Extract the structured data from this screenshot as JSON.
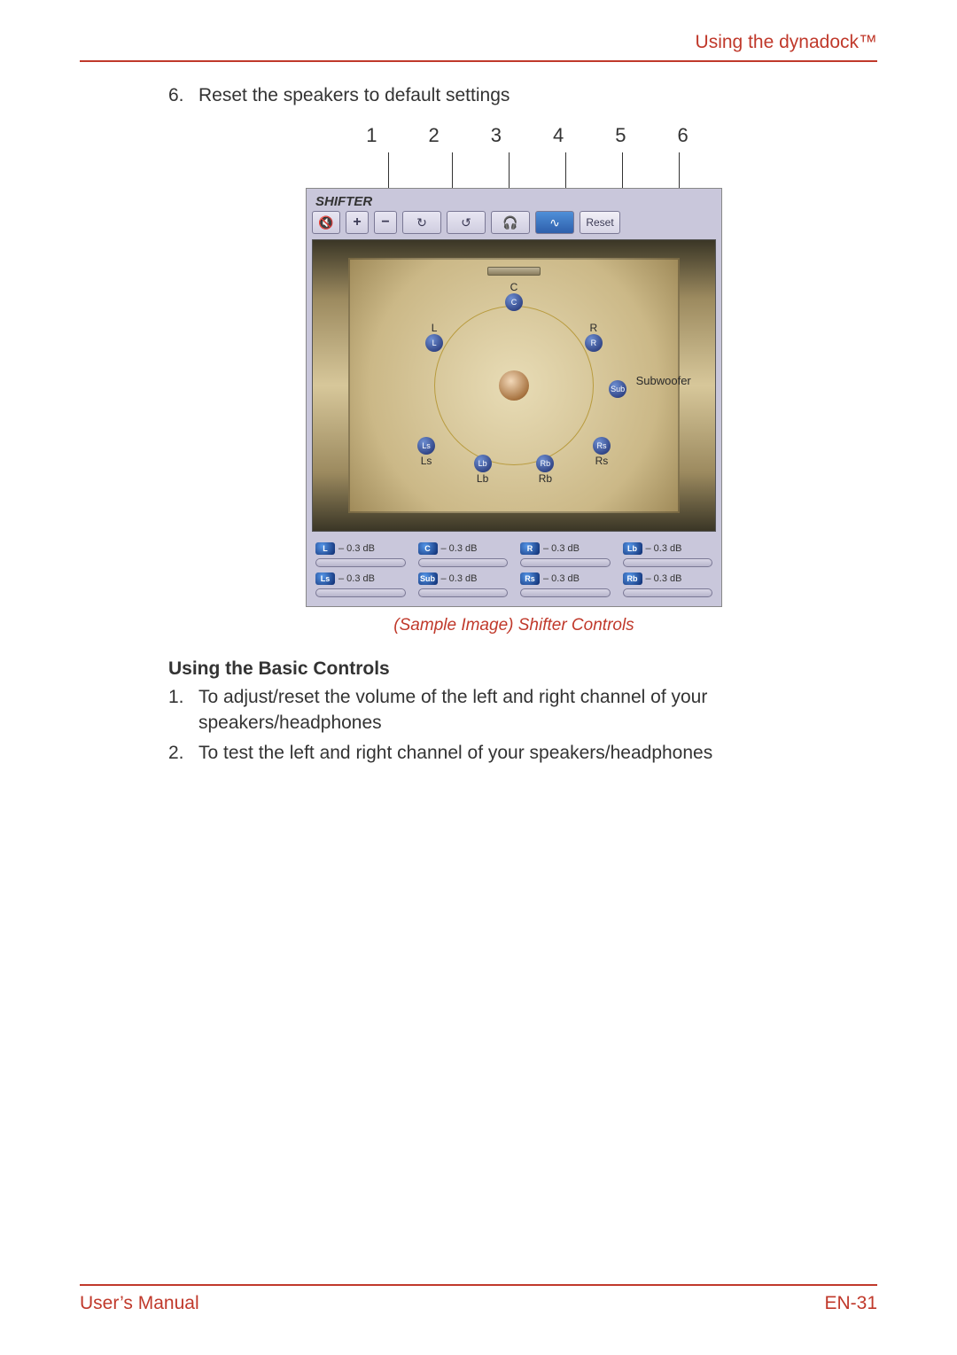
{
  "header": {
    "section_title": "Using the dynadock™"
  },
  "list6": {
    "num": "6.",
    "text": "Reset the speakers to default settings"
  },
  "callouts": [
    "1",
    "2",
    "3",
    "4",
    "5",
    "6"
  ],
  "shifter": {
    "title": "SHIFTER",
    "reset_label": "Reset",
    "speaker_labels": {
      "c": "C",
      "l": "L",
      "r": "R",
      "ls": "Ls",
      "rs": "Rs",
      "lb": "Lb",
      "rb": "Rb",
      "sub": "Sub",
      "subwoofer": "Subwoofer"
    },
    "db_readouts": [
      {
        "ch": "L",
        "val": "– 0.3 dB"
      },
      {
        "ch": "C",
        "val": "– 0.3 dB"
      },
      {
        "ch": "R",
        "val": "– 0.3 dB"
      },
      {
        "ch": "Lb",
        "val": "– 0.3 dB"
      },
      {
        "ch": "Ls",
        "val": "– 0.3 dB"
      },
      {
        "ch": "Sub",
        "val": "– 0.3 dB"
      },
      {
        "ch": "Rs",
        "val": "– 0.3 dB"
      },
      {
        "ch": "Rb",
        "val": "– 0.3 dB"
      }
    ]
  },
  "figure_caption": "(Sample Image) Shifter Controls",
  "basic": {
    "heading": "Using the Basic Controls",
    "items": [
      {
        "num": "1.",
        "text": "To adjust/reset the volume of the left and right channel of your speakers/headphones"
      },
      {
        "num": "2.",
        "text": "To test the left and right channel of your speakers/headphones"
      }
    ]
  },
  "footer": {
    "left": "User’s Manual",
    "right": "EN-31"
  }
}
